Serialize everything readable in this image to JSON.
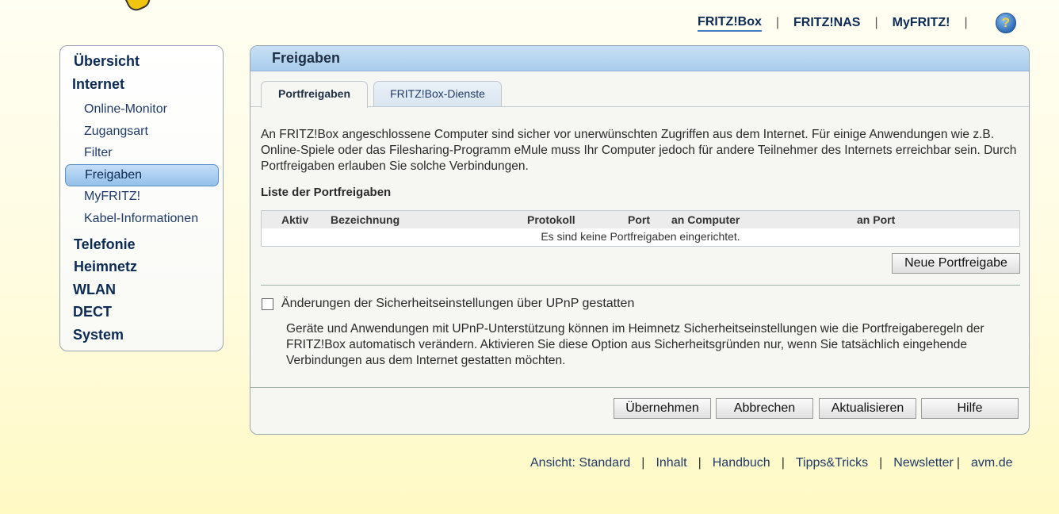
{
  "top_nav": {
    "items": [
      "FRITZ!Box",
      "FRITZ!NAS",
      "MyFRITZ!"
    ],
    "separator": "|",
    "help_glyph": "?",
    "help_icon": "help-icon"
  },
  "sidebar": {
    "overview": "Übersicht",
    "internet": "Internet",
    "internet_sub": [
      "Online-Monitor",
      "Zugangsart",
      "Filter",
      "Freigaben",
      "MyFRITZ!",
      "Kabel-Informationen"
    ],
    "telefonie": "Telefonie",
    "heimnetz": "Heimnetz",
    "wlan": "WLAN",
    "dect": "DECT",
    "system": "System"
  },
  "panel": {
    "title": "Freigaben",
    "tabs": [
      "Portfreigaben",
      "FRITZ!Box-Dienste"
    ],
    "intro": "An FRITZ!Box angeschlossene Computer sind sicher vor unerwünschten Zugriffen aus dem Internet. Für einige Anwendungen wie z.B. Online-Spiele oder das Filesharing-Programm eMule muss Ihr Computer jedoch für andere Teilnehmer des Internets erreichbar sein. Durch Portfreigaben erlauben Sie solche Verbindungen.",
    "list_title": "Liste der Portfreigaben",
    "table": {
      "headers": [
        "Aktiv",
        "Bezeichnung",
        "Protokoll",
        "Port",
        "an Computer",
        "an Port"
      ],
      "empty_text": "Es sind keine Portfreigaben eingerichtet."
    },
    "new_button": "Neue Portfreigabe",
    "upnp_checkbox_label": "Änderungen der Sicherheitseinstellungen über UPnP gestatten",
    "upnp_description": "Geräte und Anwendungen mit UPnP-Unterstützung können im Heimnetz Sicherheitseinstellungen wie die Portfreigaberegeln der FRITZ!Box automatisch verändern. Aktivieren Sie diese Option aus Sicherheitsgründen nur, wenn Sie tatsächlich eingehende Verbindungen aus dem Internet gestatten möchten.",
    "buttons": [
      "Übernehmen",
      "Abbrechen",
      "Aktualisieren",
      "Hilfe"
    ]
  },
  "footer": {
    "view": "Ansicht: Standard",
    "items": [
      "Inhalt",
      "Handbuch",
      "Tipps&Tricks",
      "Newsletter"
    ],
    "avm": "avm.de",
    "separator": "|"
  },
  "colors": {
    "accent": "#a9cdec",
    "nav_text": "#0b2b55",
    "background": "#fffce0"
  }
}
